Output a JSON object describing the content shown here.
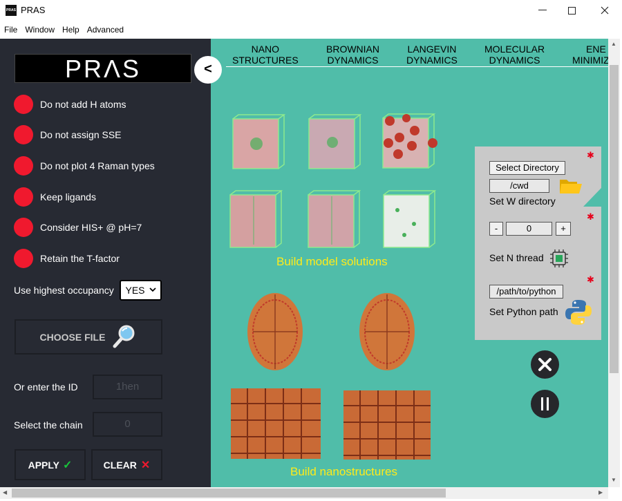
{
  "window": {
    "title": "PRAS",
    "icon_text": "PRAS",
    "controls": {
      "minimize": "—",
      "maximize": "☐",
      "close": "✕"
    }
  },
  "menu": [
    "File",
    "Window",
    "Help",
    "Advanced"
  ],
  "sidebar": {
    "logo": "PRΛS",
    "collapse_label": "<",
    "options": [
      "Do not add H atoms",
      "Do not assign SSE",
      "Do not plot 4 Raman types",
      "Keep ligands",
      "Consider HIS+ @ pH=7",
      "Retain the T-factor"
    ],
    "option_color": "#f0192e",
    "occupancy_label": "Use highest occupancy",
    "occupancy_value": "YES",
    "choose_file_label": "CHOOSE FILE",
    "id_label": "Or enter the ID",
    "id_placeholder": "1hen",
    "chain_label": "Select the chain",
    "chain_placeholder": "0",
    "apply_label": "APPLY",
    "clear_label": "CLEAR"
  },
  "tabs": [
    {
      "line1": "NANO",
      "line2": "STRUCTURES"
    },
    {
      "line1": "BROWNIAN",
      "line2": "DYNAMICS"
    },
    {
      "line1": "LANGEVIN",
      "line2": "DYNAMICS"
    },
    {
      "line1": "MOLECULAR",
      "line2": "DYNAMICS"
    },
    {
      "line1": "ENE",
      "line2": "MINIMIZ"
    }
  ],
  "sections": {
    "model_solutions": "Build model solutions",
    "nanostructures": "Build nanostructures"
  },
  "panel": {
    "select_dir_label": "Select Directory",
    "cwd_value": "/cwd",
    "wdir_label": "Set W directory",
    "thread_minus": "-",
    "thread_value": "0",
    "thread_plus": "+",
    "thread_label": "Set N thread",
    "python_path_value": "/path/to/python",
    "python_label": "Set Python path"
  },
  "main_background": "#50bda9",
  "accent_yellow": "#ffeb1a"
}
